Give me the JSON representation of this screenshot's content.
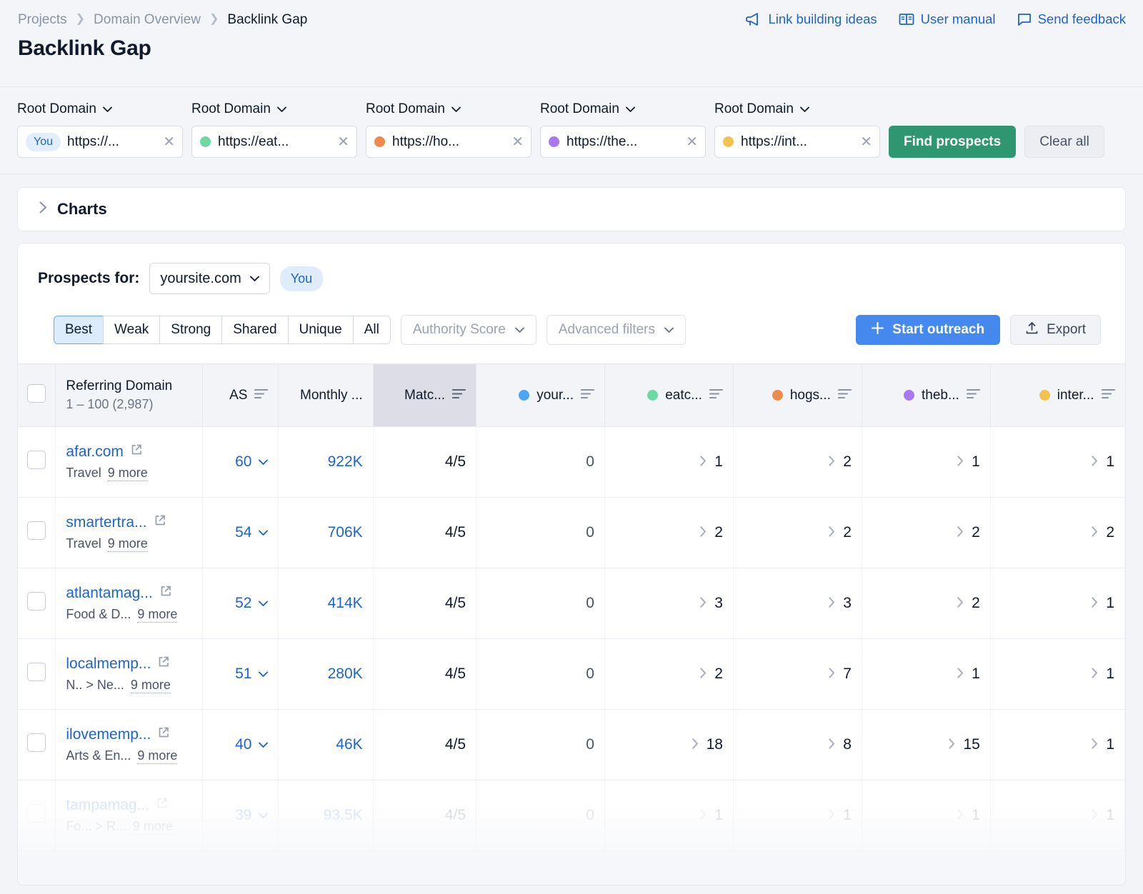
{
  "header": {
    "breadcrumb": [
      {
        "label": "Projects",
        "current": false
      },
      {
        "label": "Domain Overview",
        "current": false
      },
      {
        "label": "Backlink Gap",
        "current": true
      }
    ],
    "title": "Backlink Gap",
    "links": [
      {
        "label": "Link building ideas",
        "icon": "megaphone-icon"
      },
      {
        "label": "User manual",
        "icon": "book-icon"
      },
      {
        "label": "Send feedback",
        "icon": "chat-icon"
      }
    ]
  },
  "filter_bar": {
    "domain_label": "Root Domain",
    "domains": [
      {
        "badge": "You",
        "value": "https://...",
        "color": "#4da3f5",
        "has_badge": true
      },
      {
        "badge": "",
        "value": "https://eat...",
        "color": "#6ed9a5",
        "has_badge": false
      },
      {
        "badge": "",
        "value": "https://ho...",
        "color": "#f08a4b",
        "has_badge": false
      },
      {
        "badge": "",
        "value": "https://the...",
        "color": "#a878f0",
        "has_badge": false
      },
      {
        "badge": "",
        "value": "https://int...",
        "color": "#f5c14e",
        "has_badge": false
      }
    ],
    "find_prospects_label": "Find prospects",
    "clear_all_label": "Clear all",
    "accent_green": "#2e9771"
  },
  "charts": {
    "title": "Charts",
    "expanded": false
  },
  "prospects": {
    "label": "Prospects for:",
    "selected_site": "yoursite.com",
    "you_pill": "You"
  },
  "toolbar": {
    "segments": [
      {
        "label": "Best",
        "active": true
      },
      {
        "label": "Weak",
        "active": false
      },
      {
        "label": "Strong",
        "active": false
      },
      {
        "label": "Shared",
        "active": false
      },
      {
        "label": "Unique",
        "active": false
      },
      {
        "label": "All",
        "active": false
      }
    ],
    "authority_score_label": "Authority Score",
    "advanced_filters_label": "Advanced filters",
    "start_outreach_label": "Start outreach",
    "export_label": "Export",
    "accent_blue": "#4589ef"
  },
  "table": {
    "columns": [
      {
        "label": "Referring Domain",
        "sub": "1 – 100 (2,987)",
        "sortable": false,
        "dot": null,
        "highlight": false,
        "align": "left"
      },
      {
        "label": "AS",
        "sub": "",
        "sortable": true,
        "dot": null,
        "highlight": false,
        "align": "right"
      },
      {
        "label": "Monthly ...",
        "sub": "",
        "sortable": false,
        "dot": null,
        "highlight": false,
        "align": "right"
      },
      {
        "label": "Matc...",
        "sub": "",
        "sortable": true,
        "dot": null,
        "highlight": true,
        "align": "right"
      },
      {
        "label": "your...",
        "sub": "",
        "sortable": true,
        "dot": "#4da3f5",
        "highlight": false,
        "align": "right"
      },
      {
        "label": "eatc...",
        "sub": "",
        "sortable": true,
        "dot": "#6ed9a5",
        "highlight": false,
        "align": "right"
      },
      {
        "label": "hogs...",
        "sub": "",
        "sortable": true,
        "dot": "#f08a4b",
        "highlight": false,
        "align": "right"
      },
      {
        "label": "theb...",
        "sub": "",
        "sortable": true,
        "dot": "#a878f0",
        "highlight": false,
        "align": "right"
      },
      {
        "label": "inter...",
        "sub": "",
        "sortable": true,
        "dot": "#f5c14e",
        "highlight": false,
        "align": "right"
      }
    ],
    "more_label": "9 more",
    "rows": [
      {
        "domain": "afar.com",
        "category": "Travel",
        "as": "60",
        "monthly": "922K",
        "matched": "4/5",
        "counts": [
          "0",
          "1",
          "2",
          "1",
          "1"
        ],
        "faded": false
      },
      {
        "domain": "smartertra...",
        "category": "Travel",
        "as": "54",
        "monthly": "706K",
        "matched": "4/5",
        "counts": [
          "0",
          "2",
          "2",
          "2",
          "2"
        ],
        "faded": false
      },
      {
        "domain": "atlantamag...",
        "category": "Food & D...",
        "as": "52",
        "monthly": "414K",
        "matched": "4/5",
        "counts": [
          "0",
          "3",
          "3",
          "2",
          "1"
        ],
        "faded": false
      },
      {
        "domain": "localmemp...",
        "category": "N.. > Ne...",
        "as": "51",
        "monthly": "280K",
        "matched": "4/5",
        "counts": [
          "0",
          "2",
          "7",
          "1",
          "1"
        ],
        "faded": false
      },
      {
        "domain": "ilovememp...",
        "category": "Arts & En...",
        "as": "40",
        "monthly": "46K",
        "matched": "4/5",
        "counts": [
          "0",
          "18",
          "8",
          "15",
          "1"
        ],
        "faded": false
      },
      {
        "domain": "tampamag...",
        "category": "Fo... > R...",
        "as": "39",
        "monthly": "93.5K",
        "matched": "4/5",
        "counts": [
          "0",
          "1",
          "1",
          "1",
          "1"
        ],
        "faded": true
      }
    ]
  }
}
